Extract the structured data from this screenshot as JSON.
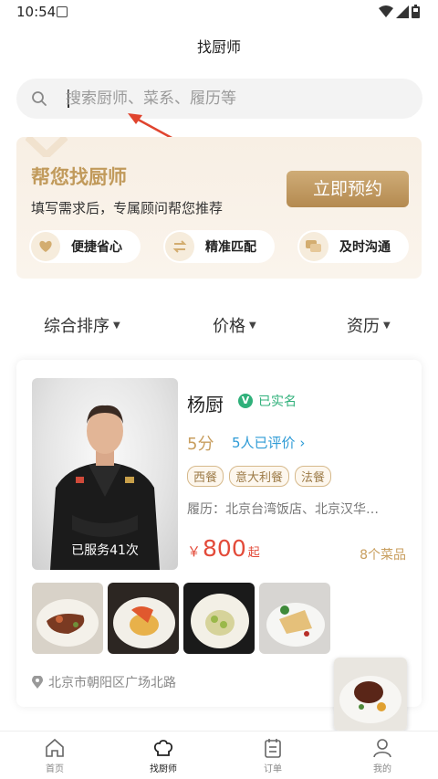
{
  "status": {
    "time": "10:54"
  },
  "nav": {
    "title": "找厨师"
  },
  "search": {
    "placeholder": "搜索厨师、菜系、履历等"
  },
  "promo": {
    "title": "帮您找厨师",
    "subtitle": "填写需求后，专属顾问帮您推荐",
    "button": "立即预约",
    "features": [
      {
        "label": "便捷省心",
        "icon": "heart-icon"
      },
      {
        "label": "精准匹配",
        "icon": "swap-icon"
      },
      {
        "label": "及时沟通",
        "icon": "chat-icon"
      }
    ]
  },
  "sort": {
    "items": [
      "综合排序",
      "价格",
      "资历"
    ]
  },
  "chef": {
    "name": "杨厨",
    "verified": "已实名",
    "score": "5分",
    "reviews": "5人已评价",
    "tags": [
      "西餐",
      "意大利餐",
      "法餐"
    ],
    "resume": "履历：北京台湾饭店、北京汉华…",
    "price_symbol": "￥",
    "price": "800",
    "price_unit": "起",
    "dish_count": "8个菜品",
    "served": "已服务41次",
    "location": "北京市朝阳区广场北路"
  },
  "tabs": [
    {
      "label": "首页",
      "icon": "home-icon"
    },
    {
      "label": "找厨师",
      "icon": "chef-hat-icon"
    },
    {
      "label": "订单",
      "icon": "order-icon"
    },
    {
      "label": "我的",
      "icon": "profile-icon"
    }
  ],
  "colors": {
    "accent_gold": "#c19a5b",
    "price_red": "#e34b3a",
    "verified_green": "#2fb07a",
    "link_blue": "#2e9bd6"
  }
}
